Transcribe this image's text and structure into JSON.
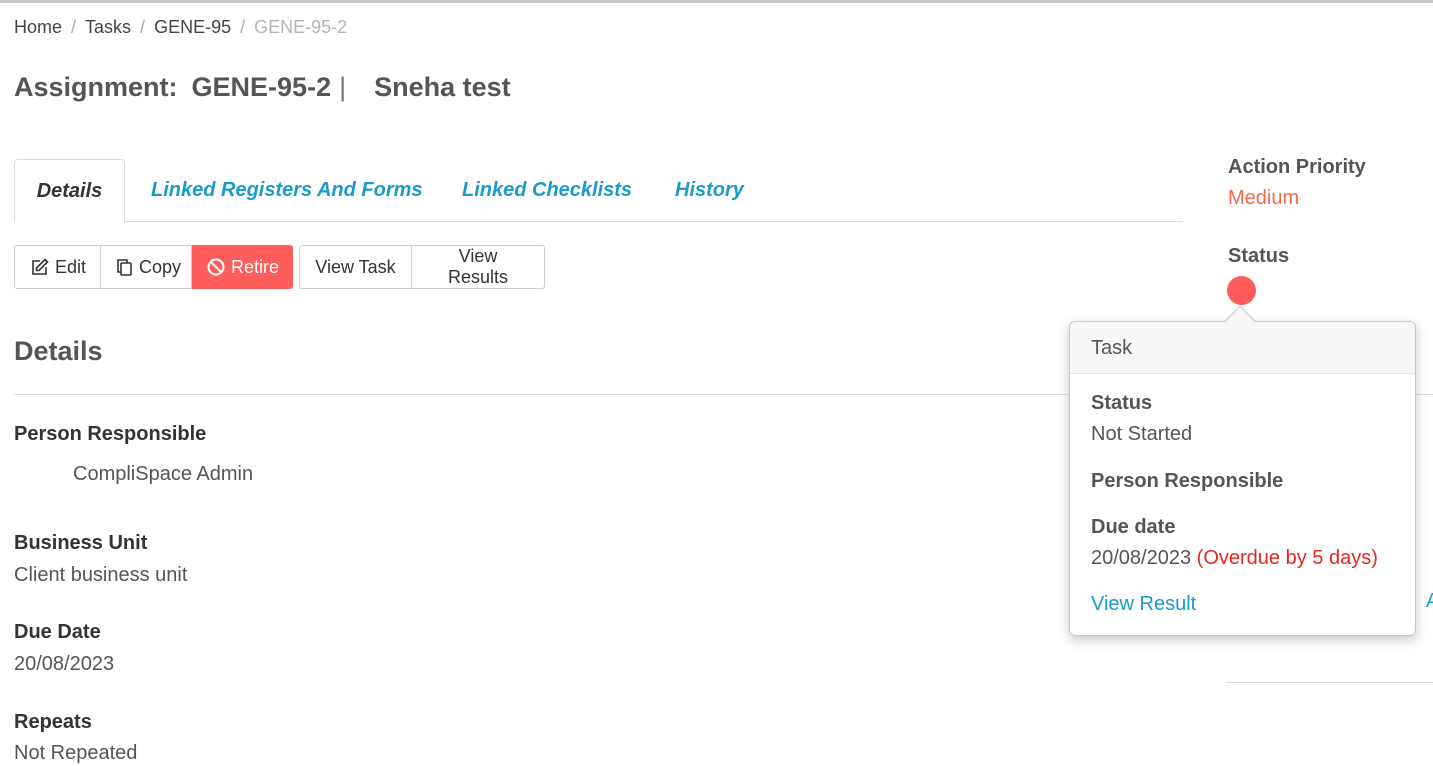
{
  "breadcrumb": {
    "items": [
      "Home",
      "Tasks",
      "GENE-95"
    ],
    "current": "GENE-95-2",
    "separator": "/"
  },
  "header": {
    "prefix": "Assignment:",
    "code": "GENE-95-2",
    "separator": "|",
    "name": "Sneha test"
  },
  "tabs": [
    {
      "label": "Details",
      "active": true
    },
    {
      "label": "Linked Registers And Forms",
      "active": false
    },
    {
      "label": "Linked Checklists",
      "active": false
    },
    {
      "label": "History",
      "active": false
    }
  ],
  "toolbar": {
    "edit_label": "Edit",
    "copy_label": "Copy",
    "retire_label": "Retire",
    "view_task_label": "View Task",
    "view_results_label": "View Results"
  },
  "details": {
    "title": "Details",
    "person_responsible_label": "Person Responsible",
    "person_responsible_value": "CompliSpace Admin",
    "business_unit_label": "Business Unit",
    "business_unit_value": "Client business unit",
    "due_date_label": "Due Date",
    "due_date_value": "20/08/2023",
    "repeats_label": "Repeats",
    "repeats_value": "Not Repeated"
  },
  "sidebar": {
    "action_priority_label": "Action Priority",
    "action_priority_value": "Medium",
    "status_label": "Status",
    "edge_glyph": "A"
  },
  "popover": {
    "title": "Task",
    "status_label": "Status",
    "status_value": "Not Started",
    "person_responsible_label": "Person Responsible",
    "due_date_label": "Due date",
    "due_date_value": "20/08/2023",
    "overdue_text": "(Overdue by 5 days)",
    "view_result_label": "View Result"
  },
  "colors": {
    "accent": "#1a9bcb",
    "danger": "#ff5c5c",
    "priority_medium": "#f26b4a",
    "overdue": "#e8261f"
  },
  "icons": {
    "edit": "edit-icon",
    "copy": "copy-icon",
    "retire": "ban-icon"
  }
}
